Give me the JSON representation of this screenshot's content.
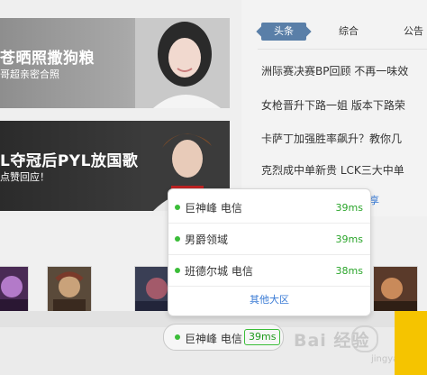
{
  "banners": [
    {
      "title": "苍晒照撒狗粮",
      "subtitle": "哥超亲密合照"
    },
    {
      "title": "L夺冠后PYL放国歌",
      "subtitle": "点赞回应！"
    }
  ],
  "news": {
    "tabs": [
      {
        "label": "头条",
        "active": true
      },
      {
        "label": "综合",
        "active": false
      },
      {
        "label": "公告",
        "active": false
      }
    ],
    "items": [
      {
        "text": "洲际赛决赛BP回顾 不再一味效"
      },
      {
        "text": "女枪晋升下路一姐 版本下路荣"
      },
      {
        "text": "卡萨丁加强胜率飙升？教你几"
      },
      {
        "text": "克烈成中单新贵 LCK三大中单"
      }
    ],
    "more_fragment": "享"
  },
  "server_dropdown": {
    "options": [
      {
        "name": "巨神峰 电信",
        "ping": "39ms"
      },
      {
        "name": "男爵领域",
        "ping": "39ms"
      },
      {
        "name": "班德尔城 电信",
        "ping": "38ms"
      }
    ],
    "more_label": "其他大区"
  },
  "server_selector": {
    "name": "巨神峰 电信",
    "ping": "39ms"
  },
  "watermark": {
    "text": "Bai 经验",
    "sub": "jingyan.baidu.com"
  },
  "colors": {
    "tab_active": "#5a7fa8",
    "ping_green": "#3bbd39",
    "link_blue": "#3a7bd5",
    "launch_yellow": "#f5c400"
  }
}
